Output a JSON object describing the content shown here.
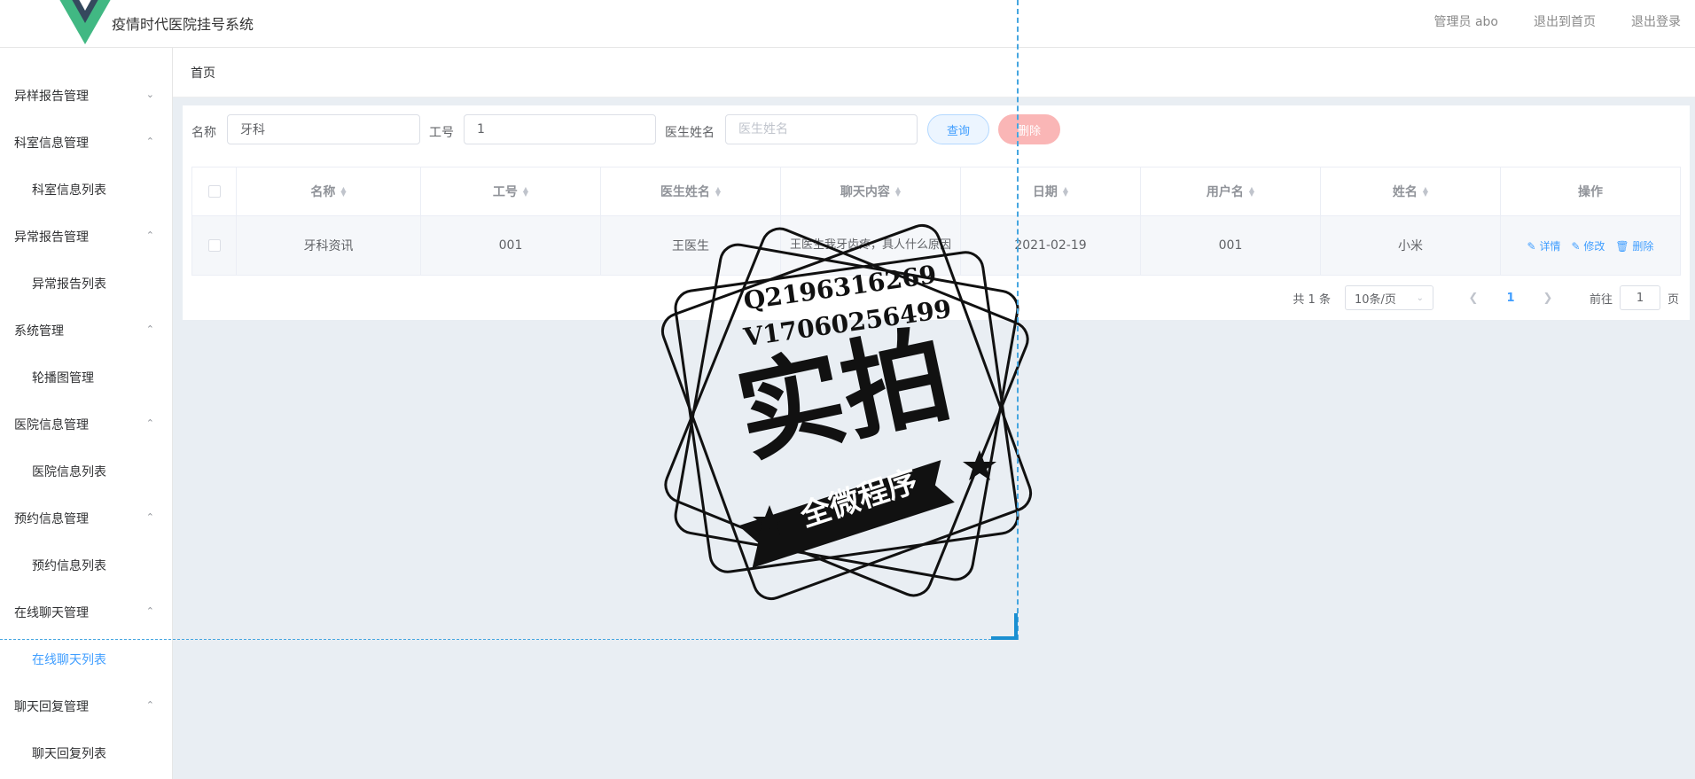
{
  "header": {
    "app_title": "疫情时代医院挂号系统",
    "admin_label": "管理员 abo",
    "back_home": "退出到首页",
    "logout": "退出登录"
  },
  "sidebar": {
    "groups": [
      {
        "label": "异样报告管理",
        "expanded": false
      },
      {
        "label": "科室信息管理",
        "expanded": true,
        "sub": "科室信息列表"
      },
      {
        "label": "异常报告管理",
        "expanded": true,
        "sub": "异常报告列表"
      },
      {
        "label": "系统管理",
        "expanded": true,
        "sub": "轮播图管理"
      },
      {
        "label": "医院信息管理",
        "expanded": true,
        "sub": "医院信息列表"
      },
      {
        "label": "预约信息管理",
        "expanded": true,
        "sub": "预约信息列表"
      },
      {
        "label": "在线聊天管理",
        "expanded": true,
        "sub": "在线聊天列表"
      },
      {
        "label": "聊天回复管理",
        "expanded": true,
        "sub": "聊天回复列表"
      }
    ],
    "active_item": "在线聊天列表"
  },
  "breadcrumb": "首页",
  "search": {
    "name_label": "名称",
    "name_value": "牙科",
    "job_label": "工号",
    "job_value": "1",
    "doctor_label": "医生姓名",
    "doctor_placeholder": "医生姓名",
    "query_button": "查询",
    "delete_button": "删除"
  },
  "table": {
    "columns": [
      "名称",
      "工号",
      "医生姓名",
      "聊天内容",
      "日期",
      "用户名",
      "姓名",
      "操作"
    ],
    "rows": [
      {
        "name": "牙科资讯",
        "job_no": "001",
        "doctor": "王医生",
        "content": "王医生我牙齿疼，具人什么原因",
        "date": "2021-02-19",
        "username": "001",
        "real_name": "小米",
        "actions": [
          "详情",
          "修改",
          "删除"
        ]
      }
    ]
  },
  "pagination": {
    "total": "共 1 条",
    "page_size": "10条/页",
    "current_page": "1",
    "goto_label": "前往",
    "goto_value": "1",
    "page_suffix": "页"
  },
  "stamp": {
    "line1": "Q2196316269",
    "line2": "V17060256499",
    "big_text": "实拍",
    "banner_text": "全微程序"
  },
  "icons": {
    "chevron_up": "chevron-up-icon",
    "chevron_down": "chevron-down-icon",
    "edit": "edit-icon",
    "trash": "trash-icon",
    "sort": "sort-icon"
  },
  "colors": {
    "primary": "#409eff",
    "danger_light": "#fab6b6",
    "bg": "#e9eef3",
    "logo_green": "#41b883",
    "logo_dark": "#35495e",
    "dashed": "#46a6e0"
  }
}
